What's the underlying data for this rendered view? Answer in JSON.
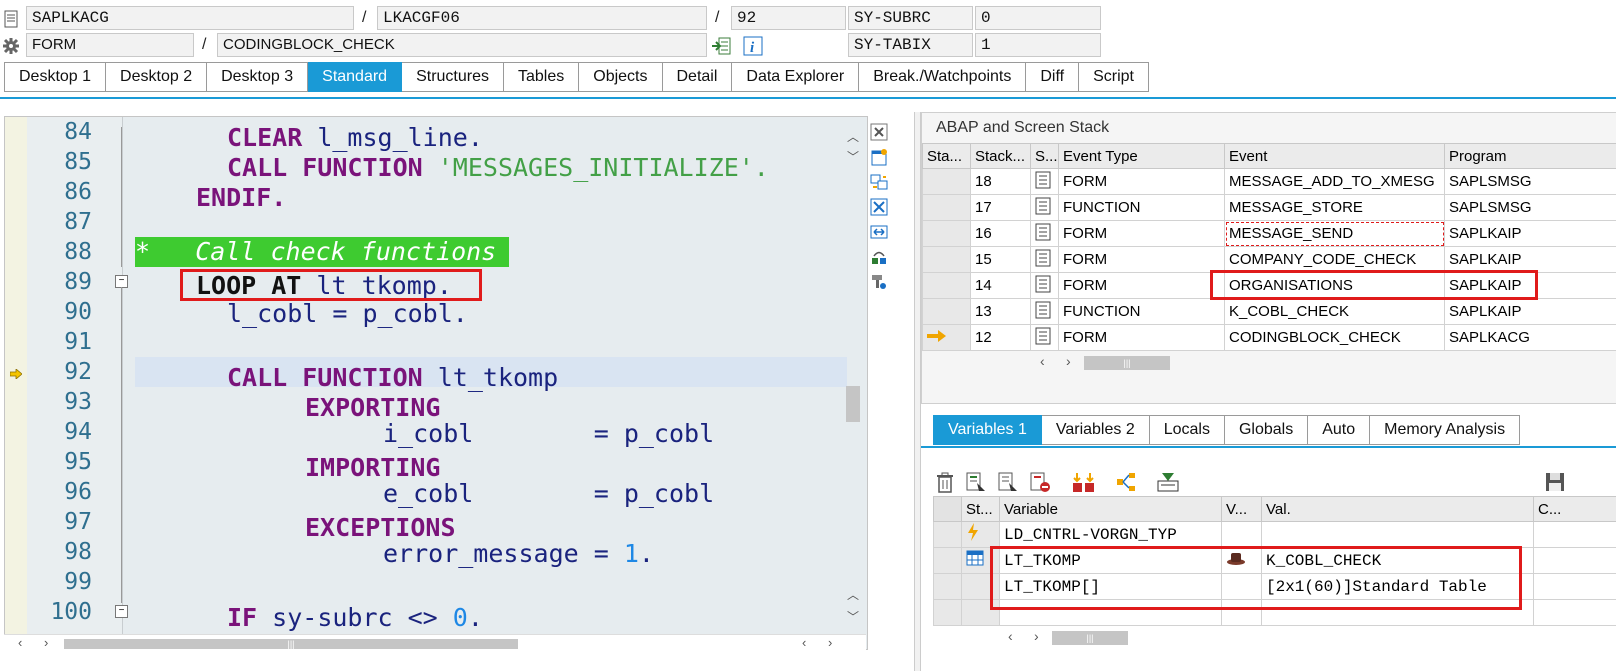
{
  "header": {
    "row1": {
      "program": "SAPLKACG",
      "include": "LKACGF06",
      "line": "92",
      "sysvar_name": "SY-SUBRC",
      "sysvar_value": "0"
    },
    "row2": {
      "event_type": "FORM",
      "event_name": "CODINGBLOCK_CHECK",
      "sysvar_name": "SY-TABIX",
      "sysvar_value": "1"
    },
    "separator": "/"
  },
  "tabs": [
    "Desktop 1",
    "Desktop 2",
    "Desktop 3",
    "Standard",
    "Structures",
    "Tables",
    "Objects",
    "Detail",
    "Data Explorer",
    "Break./Watchpoints",
    "Diff",
    "Script"
  ],
  "active_tab": "Standard",
  "editor": {
    "line_numbers": [
      "84",
      "85",
      "86",
      "87",
      "88",
      "89",
      "90",
      "91",
      "92",
      "93",
      "94",
      "95",
      "96",
      "97",
      "98",
      "99",
      "100"
    ],
    "current_line": "92",
    "code": {
      "l84_kw": "CLEAR",
      "l84_id": "l_msg_line.",
      "l85_kw": "CALL FUNCTION",
      "l85_str": "'MESSAGES_INITIALIZE'.",
      "l86_kw": "ENDIF.",
      "l88_comment": "*   Call check functions",
      "l89_kw": "LOOP AT",
      "l89_id": "lt_tkomp.",
      "l90_id": "l_cobl = p_cobl.",
      "l92_kw": "CALL FUNCTION",
      "l92_id": "lt_tkomp",
      "l93_kw": "EXPORTING",
      "l94_id": "i_cobl        = p_cobl",
      "l95_kw": "IMPORTING",
      "l96_id": "e_cobl        = p_cobl",
      "l97_kw": "EXCEPTIONS",
      "l98_id": "error_message = ",
      "l98_num": "1",
      "l98_end": ".",
      "l100_kw": "IF",
      "l100_id": "sy-subrc <> ",
      "l100_num": "0",
      "l100_end": "."
    }
  },
  "stack": {
    "title": "ABAP and Screen Stack",
    "columns": [
      "Sta...",
      "Stack...",
      "S...",
      "Event Type",
      "Event",
      "Program"
    ],
    "rows": [
      {
        "level": "18",
        "type": "FORM",
        "event": "MESSAGE_ADD_TO_XMESG",
        "program": "SAPLSMSG"
      },
      {
        "level": "17",
        "type": "FUNCTION",
        "event": "MESSAGE_STORE",
        "program": "SAPLSMSG"
      },
      {
        "level": "16",
        "type": "FORM",
        "event": "MESSAGE_SEND",
        "program": "SAPLKAIP"
      },
      {
        "level": "15",
        "type": "FORM",
        "event": "COMPANY_CODE_CHECK",
        "program": "SAPLKAIP"
      },
      {
        "level": "14",
        "type": "FORM",
        "event": "ORGANISATIONS",
        "program": "SAPLKAIP"
      },
      {
        "level": "13",
        "type": "FUNCTION",
        "event": "K_COBL_CHECK",
        "program": "SAPLKAIP"
      },
      {
        "level": "12",
        "type": "FORM",
        "event": "CODINGBLOCK_CHECK",
        "program": "SAPLKACG"
      }
    ]
  },
  "variables": {
    "tabs": [
      "Variables 1",
      "Variables 2",
      "Locals",
      "Globals",
      "Auto",
      "Memory Analysis"
    ],
    "active_tab": "Variables 1",
    "columns": [
      "St...",
      "Variable",
      "V...",
      "Val.",
      "C..."
    ],
    "rows": [
      {
        "name": "LD_CNTRL-VORGN_TYP",
        "value": ""
      },
      {
        "name": "LT_TKOMP",
        "value": "K_COBL_CHECK"
      },
      {
        "name": "LT_TKOMP[]",
        "value": "[2x1(60)]Standard Table"
      }
    ]
  },
  "scroll_grip": "|||",
  "colors": {
    "accent": "#1a9ad6",
    "highlight_box": "#e01b1b",
    "comment_bg": "#3ecb30",
    "keyword": "#7a137a"
  }
}
